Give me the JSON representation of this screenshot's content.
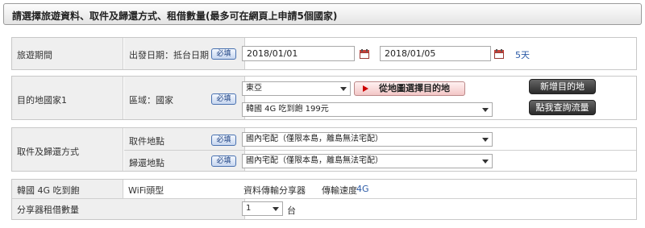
{
  "header": {
    "title": "請選擇旅遊資料、取件及歸還方式、租借數量(最多可在網頁上申請5個國家)"
  },
  "travel": {
    "label": "旅遊期間",
    "sublabel": "出發日期：抵台日期",
    "required": "必填",
    "start_date": "2018/01/01",
    "end_date": "2018/01/05",
    "days": "5天",
    "icon": "calendar-icon"
  },
  "destination": {
    "label": "目的地國家1",
    "sublabel": "區域：國家",
    "required": "必填",
    "region": "東亞",
    "map_button": "從地圖選擇目的地",
    "plan": "韓國 4G 吃到飽 199元",
    "add_button": "新增目的地",
    "check_button": "點我查詢流量"
  },
  "pickup": {
    "label": "取件及歸還方式",
    "pickup_label": "取件地點",
    "return_label": "歸還地點",
    "required": "必填",
    "pickup_value": "國內宅配（僅限本島，離島無法宅配）",
    "return_value": "國內宅配（僅限本島，離島無法宅配）"
  },
  "device": {
    "plan_label": "韓國 4G 吃到飽",
    "type_label": "WiFi頭型",
    "type_value": "資料傳輸分享器",
    "speed_label": "傳輸速度",
    "speed_value": "4G",
    "qty_label": "分享器租借數量",
    "qty_value": "1",
    "qty_unit": "台"
  },
  "colors": {
    "accent_blue": "#2b5aa6",
    "calendar_red": "#c8413a"
  }
}
